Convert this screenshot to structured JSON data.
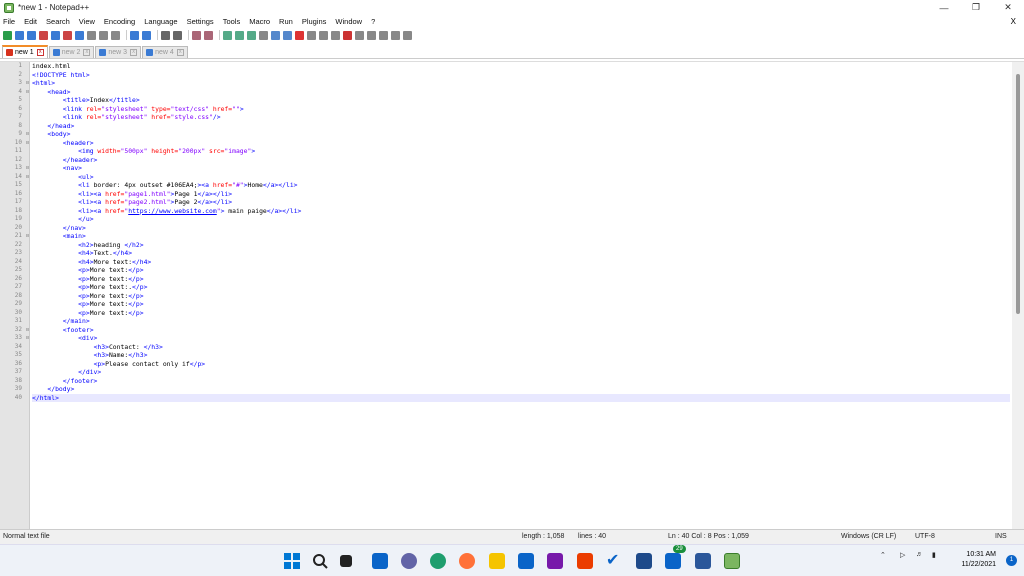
{
  "window": {
    "title": "*new 1 - Notepad++"
  },
  "menu": [
    "File",
    "Edit",
    "Search",
    "View",
    "Encoding",
    "Language",
    "Settings",
    "Tools",
    "Macro",
    "Run",
    "Plugins",
    "Window",
    "?"
  ],
  "menu_close": "X",
  "tabs": [
    {
      "label": "new 1",
      "active": true
    },
    {
      "label": "new 2",
      "active": false
    },
    {
      "label": "new 3",
      "active": false
    },
    {
      "label": "new 4",
      "active": false
    }
  ],
  "code_lines": [
    [
      [
        "txt",
        "index.html"
      ]
    ],
    [
      [
        "tag",
        "<!DOCTYPE html>"
      ]
    ],
    [
      [
        "tag",
        "<html>"
      ]
    ],
    [
      [
        "txt",
        "    "
      ],
      [
        "tag",
        "<head>"
      ]
    ],
    [
      [
        "txt",
        "        "
      ],
      [
        "tag",
        "<title>"
      ],
      [
        "txt",
        "Index"
      ],
      [
        "tag",
        "</title>"
      ]
    ],
    [
      [
        "txt",
        "        "
      ],
      [
        "tag",
        "<link "
      ],
      [
        "attr",
        "rel="
      ],
      [
        "str",
        "\"stylesheet\" "
      ],
      [
        "attr",
        "type="
      ],
      [
        "str",
        "\"text/css\" "
      ],
      [
        "attr",
        "href="
      ],
      [
        "str",
        "\"\""
      ],
      [
        "tag",
        ">"
      ]
    ],
    [
      [
        "txt",
        "        "
      ],
      [
        "tag",
        "<link "
      ],
      [
        "attr",
        "rel="
      ],
      [
        "str",
        "\"stylesheet\" "
      ],
      [
        "attr",
        "href="
      ],
      [
        "str",
        "\"style.css\""
      ],
      [
        "tag",
        "/>"
      ]
    ],
    [
      [
        "txt",
        "    "
      ],
      [
        "tag",
        "</head>"
      ]
    ],
    [
      [
        "txt",
        "    "
      ],
      [
        "tag",
        "<body>"
      ]
    ],
    [
      [
        "txt",
        "        "
      ],
      [
        "tag",
        "<header>"
      ]
    ],
    [
      [
        "txt",
        "            "
      ],
      [
        "tag",
        "<img "
      ],
      [
        "attr",
        "width="
      ],
      [
        "str",
        "\"500px\" "
      ],
      [
        "attr",
        "height="
      ],
      [
        "str",
        "\"200px\" "
      ],
      [
        "attr",
        "src="
      ],
      [
        "str",
        "\"image\""
      ],
      [
        "tag",
        ">"
      ]
    ],
    [
      [
        "txt",
        "        "
      ],
      [
        "tag",
        "</header>"
      ]
    ],
    [
      [
        "txt",
        "        "
      ],
      [
        "tag",
        "<nav>"
      ]
    ],
    [
      [
        "txt",
        "            "
      ],
      [
        "tag",
        "<ul>"
      ]
    ],
    [
      [
        "txt",
        "            "
      ],
      [
        "tag",
        "<li "
      ],
      [
        "txt",
        "border: 4px outset #106EA4;"
      ],
      [
        "tag",
        "><a "
      ],
      [
        "attr",
        "href="
      ],
      [
        "str",
        "\"#\""
      ],
      [
        "tag",
        ">"
      ],
      [
        "txt",
        "Home"
      ],
      [
        "tag",
        "</a></li>"
      ]
    ],
    [
      [
        "txt",
        "            "
      ],
      [
        "tag",
        "<li><a "
      ],
      [
        "attr",
        "href="
      ],
      [
        "str",
        "\"page1.html\""
      ],
      [
        "tag",
        ">"
      ],
      [
        "txt",
        "Page 1"
      ],
      [
        "tag",
        "</a></li>"
      ]
    ],
    [
      [
        "txt",
        "            "
      ],
      [
        "tag",
        "<li><a "
      ],
      [
        "attr",
        "href="
      ],
      [
        "str",
        "\"page2.html\""
      ],
      [
        "tag",
        ">"
      ],
      [
        "txt",
        "Page 2"
      ],
      [
        "tag",
        "</a></li>"
      ]
    ],
    [
      [
        "txt",
        "            "
      ],
      [
        "tag",
        "<li><a "
      ],
      [
        "attr",
        "href="
      ],
      [
        "str",
        "\""
      ],
      [
        "link",
        "https://www.website.com"
      ],
      [
        "str",
        "\""
      ],
      [
        "tag",
        ">"
      ],
      [
        "txt",
        " main paige"
      ],
      [
        "tag",
        "</a></li>"
      ]
    ],
    [
      [
        "txt",
        "            "
      ],
      [
        "tag",
        "</u>"
      ]
    ],
    [
      [
        "txt",
        "        "
      ],
      [
        "tag",
        "</nav>"
      ]
    ],
    [
      [
        "txt",
        "        "
      ],
      [
        "tag",
        "<main>"
      ]
    ],
    [
      [
        "txt",
        "            "
      ],
      [
        "tag",
        "<h2>"
      ],
      [
        "txt",
        "heading "
      ],
      [
        "tag",
        "</h2>"
      ]
    ],
    [
      [
        "txt",
        "            "
      ],
      [
        "tag",
        "<h4>"
      ],
      [
        "txt",
        "Text."
      ],
      [
        "tag",
        "</h4>"
      ]
    ],
    [
      [
        "txt",
        "            "
      ],
      [
        "tag",
        "<h4>"
      ],
      [
        "txt",
        "More text:"
      ],
      [
        "tag",
        "</h4>"
      ]
    ],
    [
      [
        "txt",
        "            "
      ],
      [
        "tag",
        "<p>"
      ],
      [
        "txt",
        "More text:"
      ],
      [
        "tag",
        "</p>"
      ]
    ],
    [
      [
        "txt",
        "            "
      ],
      [
        "tag",
        "<p>"
      ],
      [
        "txt",
        "More text:"
      ],
      [
        "tag",
        "</p>"
      ]
    ],
    [
      [
        "txt",
        "            "
      ],
      [
        "tag",
        "<p>"
      ],
      [
        "txt",
        "More text:."
      ],
      [
        "tag",
        "</p>"
      ]
    ],
    [
      [
        "txt",
        "            "
      ],
      [
        "tag",
        "<p>"
      ],
      [
        "txt",
        "More text:"
      ],
      [
        "tag",
        "</p>"
      ]
    ],
    [
      [
        "txt",
        "            "
      ],
      [
        "tag",
        "<p>"
      ],
      [
        "txt",
        "More text:"
      ],
      [
        "tag",
        "</p>"
      ]
    ],
    [
      [
        "txt",
        "            "
      ],
      [
        "tag",
        "<p>"
      ],
      [
        "txt",
        "More text:"
      ],
      [
        "tag",
        "</p>"
      ]
    ],
    [
      [
        "txt",
        "        "
      ],
      [
        "tag",
        "</main>"
      ]
    ],
    [
      [
        "txt",
        "        "
      ],
      [
        "tag",
        "<footer>"
      ]
    ],
    [
      [
        "txt",
        "            "
      ],
      [
        "tag",
        "<div>"
      ]
    ],
    [
      [
        "txt",
        "                "
      ],
      [
        "tag",
        "<h3>"
      ],
      [
        "txt",
        "Contact: "
      ],
      [
        "tag",
        "</h3>"
      ]
    ],
    [
      [
        "txt",
        "                "
      ],
      [
        "tag",
        "<h3>"
      ],
      [
        "txt",
        "Name:"
      ],
      [
        "tag",
        "</h3>"
      ]
    ],
    [
      [
        "txt",
        "                "
      ],
      [
        "tag",
        "<p>"
      ],
      [
        "txt",
        "Please contact only if"
      ],
      [
        "tag",
        "</p>"
      ]
    ],
    [
      [
        "txt",
        "            "
      ],
      [
        "tag",
        "</div>"
      ]
    ],
    [
      [
        "txt",
        "        "
      ],
      [
        "tag",
        "</footer>"
      ]
    ],
    [
      [
        "txt",
        "    "
      ],
      [
        "tag",
        "</body>"
      ]
    ],
    [
      [
        "tag",
        "</html>"
      ]
    ]
  ],
  "current_line": 40,
  "status": {
    "file_type": "Normal text file",
    "length": "length : 1,058",
    "lines": "lines : 40",
    "position": "Ln : 40    Col : 8    Pos : 1,059",
    "eol": "Windows (CR LF)",
    "encoding": "UTF-8",
    "mode": "INS"
  },
  "taskbar": {
    "time": "10:31 AM",
    "date": "11/22/2021",
    "badge": "29",
    "notifications": "1"
  }
}
